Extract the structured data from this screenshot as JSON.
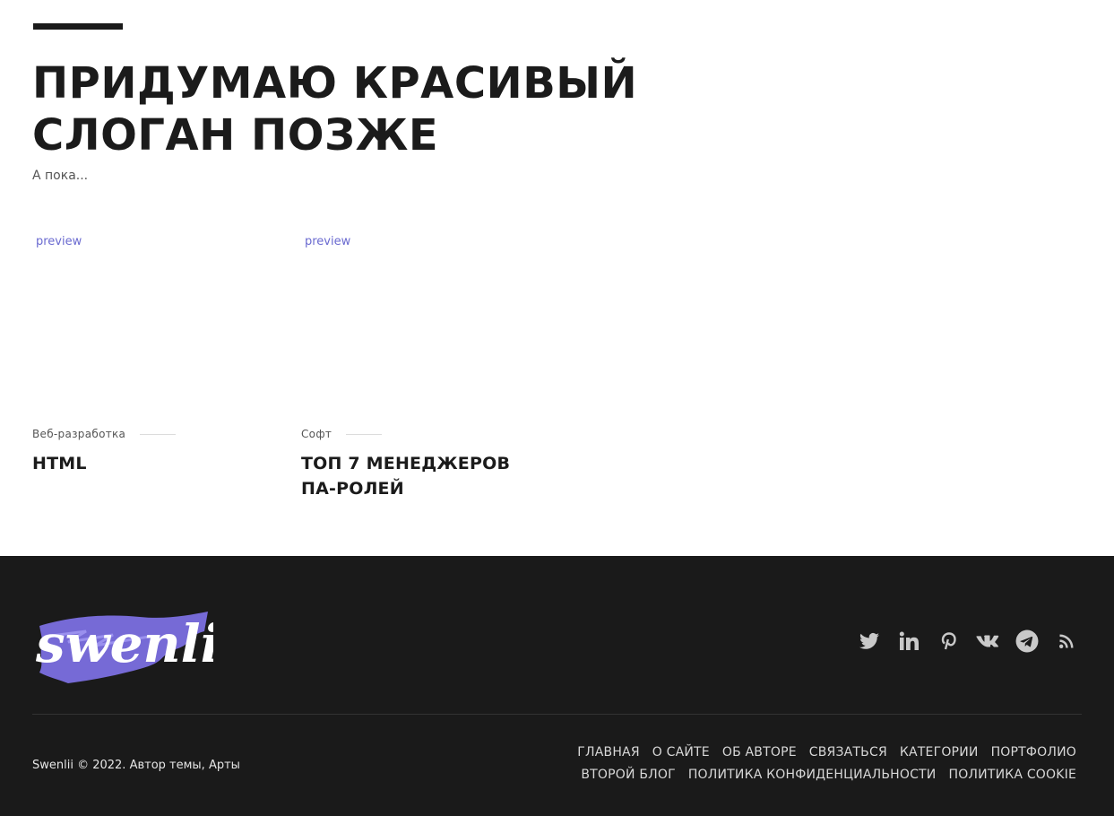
{
  "hero": {
    "title": "ПРИДУМАЮ КРАСИВЫЙ СЛОГАН ПОЗЖЕ",
    "subtitle": "А пока..."
  },
  "posts": [
    {
      "preview": "preview",
      "category": "Веб-разработка",
      "title": "HTML"
    },
    {
      "preview": "preview",
      "category": "Софт",
      "title": "ТОП 7 МЕНЕДЖЕРОВ ПА-РОЛЕЙ"
    }
  ],
  "footer": {
    "logo_text": "swenlii",
    "brand_color": "#7b6fe0",
    "socials": [
      "twitter-icon",
      "linkedin-icon",
      "pinterest-icon",
      "vk-icon",
      "telegram-icon",
      "rss-icon"
    ],
    "copyright": "Swenlii © 2022. Автор темы, Арты",
    "nav_row1": [
      "ГЛАВНАЯ",
      "О САЙТЕ",
      "ОБ АВТОРЕ",
      "СВЯЗАТЬСЯ",
      "КАТЕГОРИИ",
      "ПОРТФОЛИО"
    ],
    "nav_row2": [
      "ВТОРОЙ БЛОГ",
      "ПОЛИТИКА КОНФИДЕНЦИАЛЬНОСТИ",
      "ПОЛИТИКА COOKIE"
    ]
  }
}
